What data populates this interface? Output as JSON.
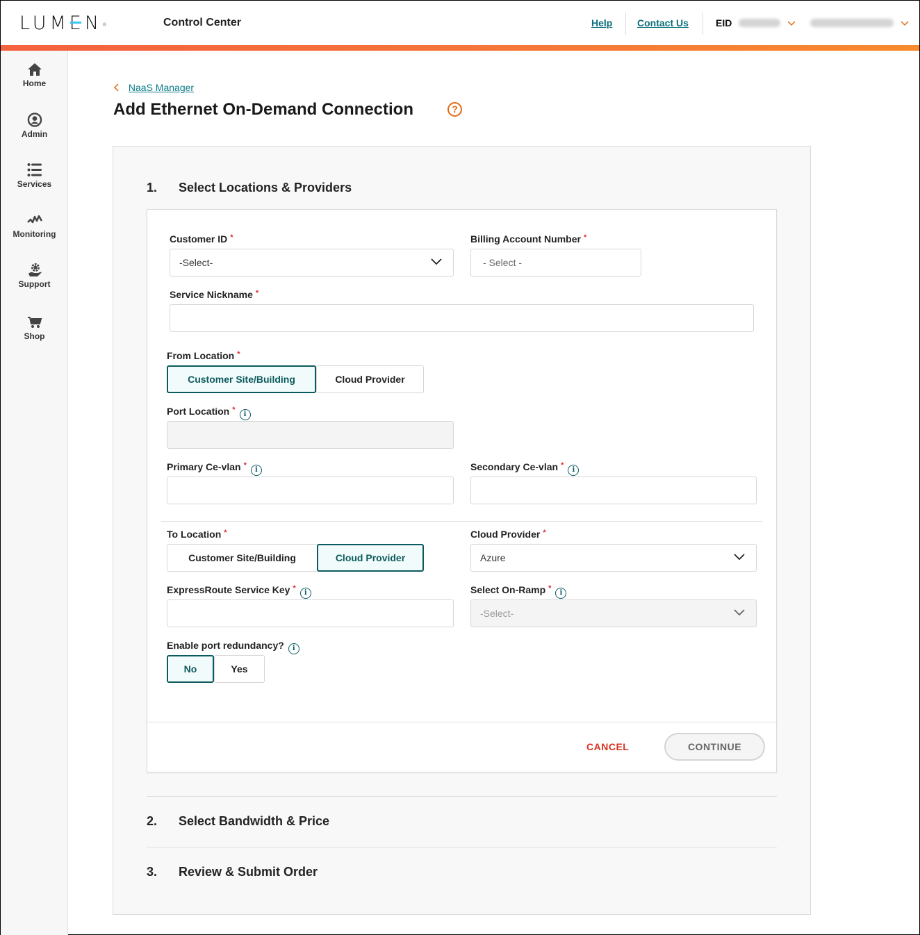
{
  "header": {
    "logo": "LUMEN",
    "app_title": "Control Center",
    "help_link": "Help",
    "contact_link": "Contact Us",
    "eid_label": "EID"
  },
  "sidebar": {
    "items": [
      {
        "label": "Home",
        "icon": "home-icon"
      },
      {
        "label": "Admin",
        "icon": "user-circle-icon"
      },
      {
        "label": "Services",
        "icon": "list-icon"
      },
      {
        "label": "Monitoring",
        "icon": "pulse-icon"
      },
      {
        "label": "Support",
        "icon": "support-gear-hand-icon"
      },
      {
        "label": "Shop",
        "icon": "cart-icon"
      }
    ]
  },
  "breadcrumb": {
    "back_label": "NaaS Manager"
  },
  "page": {
    "title": "Add Ethernet On-Demand Connection",
    "help_glyph": "?"
  },
  "steps": [
    {
      "num": "1.",
      "title": "Select Locations & Providers"
    },
    {
      "num": "2.",
      "title": "Select Bandwidth & Price"
    },
    {
      "num": "3.",
      "title": "Review & Submit Order"
    }
  ],
  "form": {
    "customer_id": {
      "label": "Customer ID",
      "value": "-Select-"
    },
    "billing_account": {
      "label": "Billing Account Number",
      "value": "- Select -"
    },
    "service_nickname": {
      "label": "Service Nickname",
      "value": ""
    },
    "from_location": {
      "label": "From Location",
      "options": [
        "Customer Site/Building",
        "Cloud Provider"
      ],
      "selected": "Customer Site/Building"
    },
    "port_location": {
      "label": "Port Location",
      "value": ""
    },
    "primary_cevlan": {
      "label": "Primary Ce-vlan",
      "value": ""
    },
    "secondary_cevlan": {
      "label": "Secondary Ce-vlan",
      "value": ""
    },
    "to_location": {
      "label": "To Location",
      "options": [
        "Customer Site/Building",
        "Cloud Provider"
      ],
      "selected": "Cloud Provider"
    },
    "cloud_provider": {
      "label": "Cloud Provider",
      "value": "Azure"
    },
    "expressroute_key": {
      "label": "ExpressRoute Service Key",
      "value": ""
    },
    "on_ramp": {
      "label": "Select On-Ramp",
      "value": "-Select-"
    },
    "port_redundancy": {
      "label": "Enable port redundancy?",
      "options": [
        "No",
        "Yes"
      ],
      "selected": "No"
    },
    "required_mark": "*",
    "info_glyph": "i"
  },
  "actions": {
    "cancel": "CANCEL",
    "continue": "CONTINUE"
  },
  "colors": {
    "accent_teal": "#0b5a5e",
    "link_teal": "#0b7a87",
    "orange": "#e36a12",
    "cancel_red": "#d6331f"
  }
}
